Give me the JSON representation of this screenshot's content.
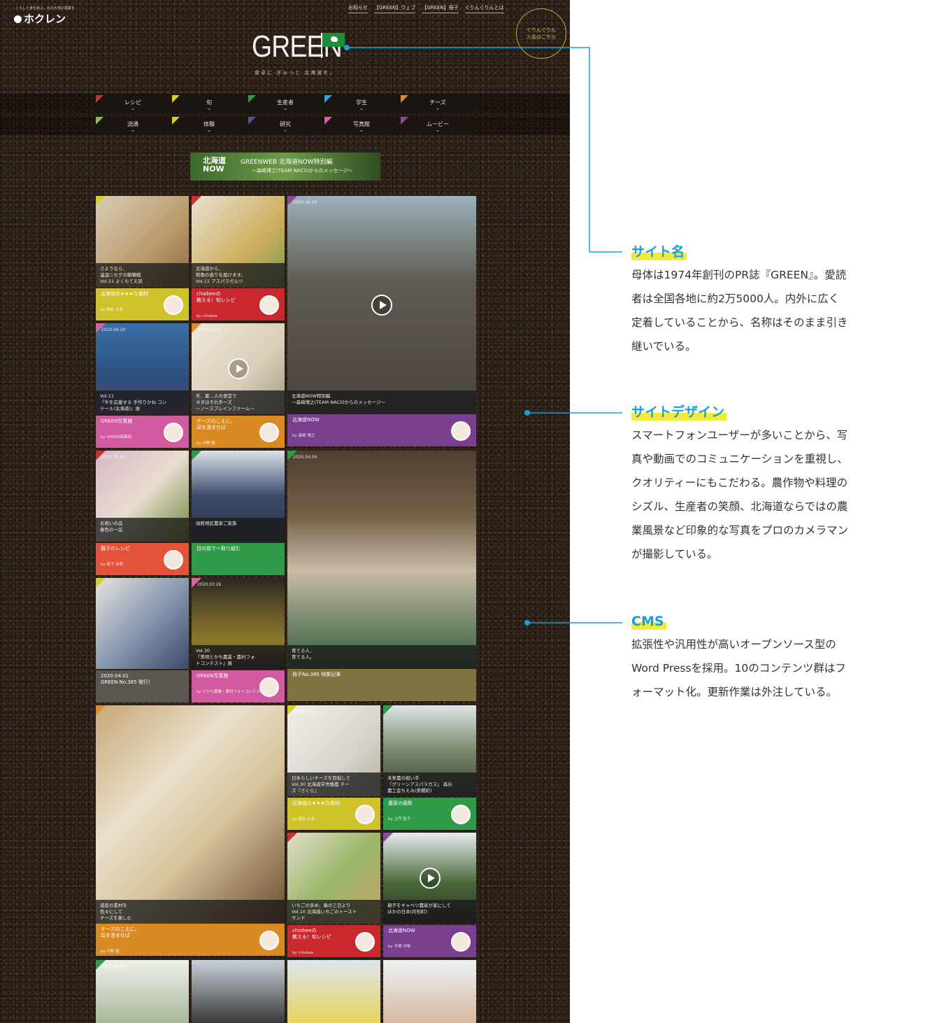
{
  "site": {
    "logo_tag": "くらしと食を結ぶ、北の大地の農業を",
    "logo": "ホクレン",
    "top_links": [
      "お知らせ",
      "【GREEN】ウェブ",
      "【GREEN】冊子",
      "ぐりんぐりんとは"
    ],
    "badge": [
      "ぐりんぐりん",
      "入会はこちら"
    ],
    "title": "GREEN",
    "subtitle": "食卓に ぎゅっと 北海道を。",
    "nav_row1": [
      {
        "label": "レシピ",
        "color": "#c83232"
      },
      {
        "label": "旬",
        "color": "#d7cf28"
      },
      {
        "label": "生産者",
        "color": "#2f9a48"
      },
      {
        "label": "学生",
        "color": "#3aa0d8"
      },
      {
        "label": "チーズ",
        "color": "#e08a2a"
      }
    ],
    "nav_row2": [
      {
        "label": "流通",
        "color": "#88c04a"
      },
      {
        "label": "体験",
        "color": "#d7cf28"
      },
      {
        "label": "研究",
        "color": "#5a4fa8"
      },
      {
        "label": "写真館",
        "color": "#d463a8"
      },
      {
        "label": "ムービー",
        "color": "#8a4a9a"
      }
    ],
    "banner": {
      "now": "北海道\nNOW",
      "main": "GREENWEB 北海道NOW特別編",
      "sub": "～森崎博之(TEAM NACS)からのメッセージ～"
    },
    "cards": [
      {
        "caption": "さようなら、\n温湿ニセグの朝積戦\nVol.11 よくもてえ話",
        "category": "北海道の★★★な食材",
        "by": "by 稲佐 広幸",
        "cat_color": "#cfc22a",
        "tri": "#d7cf28"
      },
      {
        "caption": "北海道から、\n和歌の香りを届けます。\nVol.11 アスパラガルツ",
        "category": "chiobeeの\n教える！旬レシピ",
        "by": "by chiobee",
        "cat_color": "#c8282e",
        "tri": "#c83232"
      },
      {
        "date": "2020.06.20",
        "caption": "北海道NOW特別編\n～森崎博之(TEAM NACS)からのメッセージ～",
        "category": "北海道NOW",
        "by": "by 森崎 博之",
        "cat_color": "#7a3f8e",
        "tri": "#8a4a9a"
      },
      {
        "date": "2020.06.20",
        "caption": "Vol.11\n『牛を応援する 手作りかね コン\nテール(北海道)』展",
        "category": "GREEN写真館",
        "by": "by GREEN編集部",
        "cat_color": "#d25aa0",
        "tri": "#d463a8"
      },
      {
        "date": "2020.05.21",
        "caption": "冬、夏…人の食堂で\nネタはそれ手ーズ\n～ノースプレインファーム～",
        "category": "チーズのこえに、\n耳を澄ませば",
        "by": "by 今野 聡",
        "cat_color": "#d98a22",
        "tri": "#e08a2a"
      },
      {
        "date": "2020.05.03",
        "caption": "お祝いの品\n春色の一品",
        "category": "親子のレシピ",
        "by": "by 坂下 友和",
        "cat_color": "#e2533a",
        "tri": "#c83232"
      },
      {
        "caption": "函館地区農家ご家族",
        "category": "目の前で～取り組む",
        "by": "",
        "cat_color": "#2f9a48",
        "tri": "#2f9a48"
      },
      {
        "date": "2020.04.04",
        "caption": "育てる人、\n育てる人。",
        "category": "冊子No.385 特集記事",
        "by": "",
        "cat_color": "#7f7440",
        "tri": "#2f9a48"
      },
      {
        "caption": "",
        "category": "2020.04.01\nGREEN No.385 発行！",
        "by": "",
        "cat_color": "#5a5650",
        "tri": "#d7cf28"
      },
      {
        "date": "2020.03.26",
        "caption": "Vol.30\n『美唄とかち農業・農村フォ\nトコンテスト』展",
        "category": "GREEN写真館",
        "by": "by とかち農業・農村フォトコンテスト",
        "cat_color": "#d25aa0",
        "tri": "#d463a8"
      },
      {
        "caption": "道産の素材を\n色々にして\nチーズを楽しむ",
        "category": "チーズのこえに、\n耳を澄ませば",
        "by": "by 今野 聡",
        "cat_color": "#d98a22",
        "tri": "#e08a2a"
      },
      {
        "date": "2020.03.13",
        "caption": "日本らしいチーズを目指して\nVol.30 北海道学舎酪農 チー\nズ『さくら』",
        "category": "北海道の★★★な食材",
        "by": "by 稲佐 広幸",
        "cat_color": "#cfc22a",
        "tri": "#d7cf28"
      },
      {
        "caption": "未来農の担い手\n『グリーンアスパラガス』 森谷\n農工会ちえみ(美幌町)",
        "category": "農家の面影",
        "by": "by 土門 智子",
        "cat_color": "#2f9a48",
        "tri": "#2f9a48"
      },
      {
        "caption": "いちごの多め、春の三日より\nVol.10 北海道いちごのトースト\nサンド",
        "category": "chiobeeの\n教える！旬レシピ",
        "by": "by chiobee",
        "cat_color": "#c8282e",
        "tri": "#c83232"
      },
      {
        "caption": "親子をキャベツ農家が家にして\nほかの日本(月形町)",
        "category": "北海道NOW",
        "by": "by 平塚 洋和",
        "cat_color": "#7a3f8e",
        "tri": "#8a4a9a"
      },
      {
        "date": "2020.02.29",
        "caption": "",
        "category": "",
        "by": "",
        "cat_color": "",
        "tri": "#2f9a48"
      }
    ]
  },
  "annotations": [
    {
      "heading": "サイト名",
      "lines": [
        "母体は1974年創刊のPR誌『GREEN』。愛読",
        "者は全国各地に約2万5000人。内外に広く",
        "定着していることから、名称はそのまま引き",
        "継いでいる。"
      ]
    },
    {
      "heading": "サイトデザイン",
      "lines": [
        "スマートフォンユーザーが多いことから、写",
        "真や動画でのコミュニケーションを重視し、",
        "クオリティーにもこだわる。農作物や料理の",
        "シズル、生産者の笑顔、北海道ならではの農",
        "業風景など印象的な写真をプロのカメラマン",
        "が撮影している。"
      ]
    },
    {
      "heading": "CMS",
      "lines": [
        "拡張性や汎用性が高いオープンソース型の",
        "Word Pressを採用。10のコンテンツ群はフ",
        "ォーマット化。更新作業は外注している。"
      ]
    }
  ],
  "colors": {
    "annotation_heading": "#1aa0d9",
    "highlight": "#f3ea3a",
    "leader_line": "#1aa0d9"
  }
}
